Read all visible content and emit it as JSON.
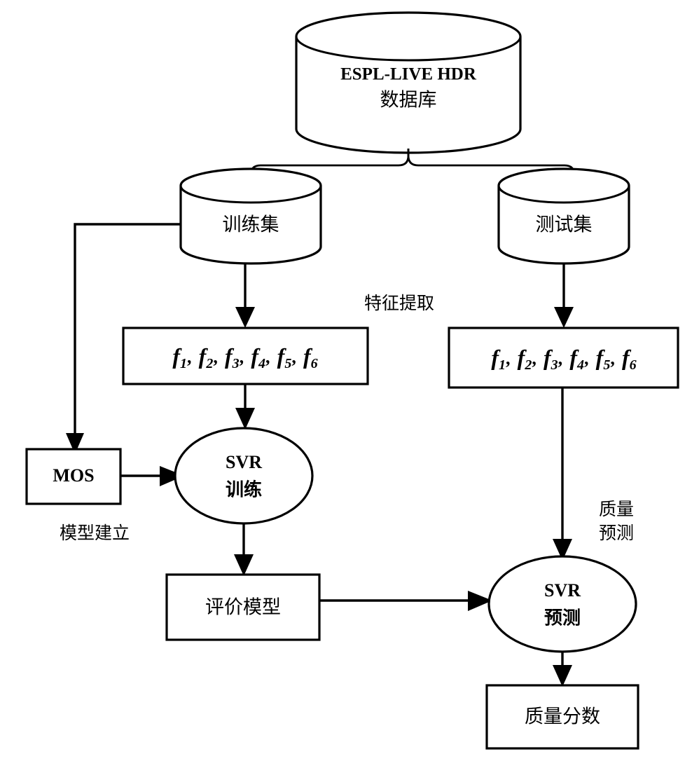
{
  "diagram": {
    "title": "HDR image quality assessment SVR flowchart",
    "background_color": "#ffffff",
    "stroke_color": "#000000"
  },
  "nodes": {
    "database": {
      "label_line1": "ESPL-LIVE HDR",
      "label_line2": "数据库",
      "shape": "cylinder"
    },
    "train_set": {
      "label": "训练集",
      "shape": "cylinder"
    },
    "test_set": {
      "label": "测试集",
      "shape": "cylinder"
    },
    "features_train": {
      "items": [
        "f",
        "1",
        "f",
        "2",
        "f",
        "3",
        "f",
        "4",
        "f",
        "5",
        "f",
        "6"
      ],
      "separator": ",",
      "shape": "rectangle"
    },
    "features_test": {
      "items": [
        "f",
        "1",
        "f",
        "2",
        "f",
        "3",
        "f",
        "4",
        "f",
        "5",
        "f",
        "6"
      ],
      "separator": ",",
      "shape": "rectangle"
    },
    "mos": {
      "label": "MOS",
      "shape": "rectangle"
    },
    "svr_train": {
      "label_line1": "SVR",
      "label_line2": "训练",
      "shape": "ellipse"
    },
    "eval_model": {
      "label": "评价模型",
      "shape": "rectangle"
    },
    "svr_predict": {
      "label_line1": "SVR",
      "label_line2": "预测",
      "shape": "ellipse"
    },
    "quality_score": {
      "label": "质量分数",
      "shape": "rectangle"
    }
  },
  "annotations": {
    "feature_extraction": "特征提取",
    "model_building": "模型建立",
    "quality_prediction_line1": "质量",
    "quality_prediction_line2": "预测"
  }
}
